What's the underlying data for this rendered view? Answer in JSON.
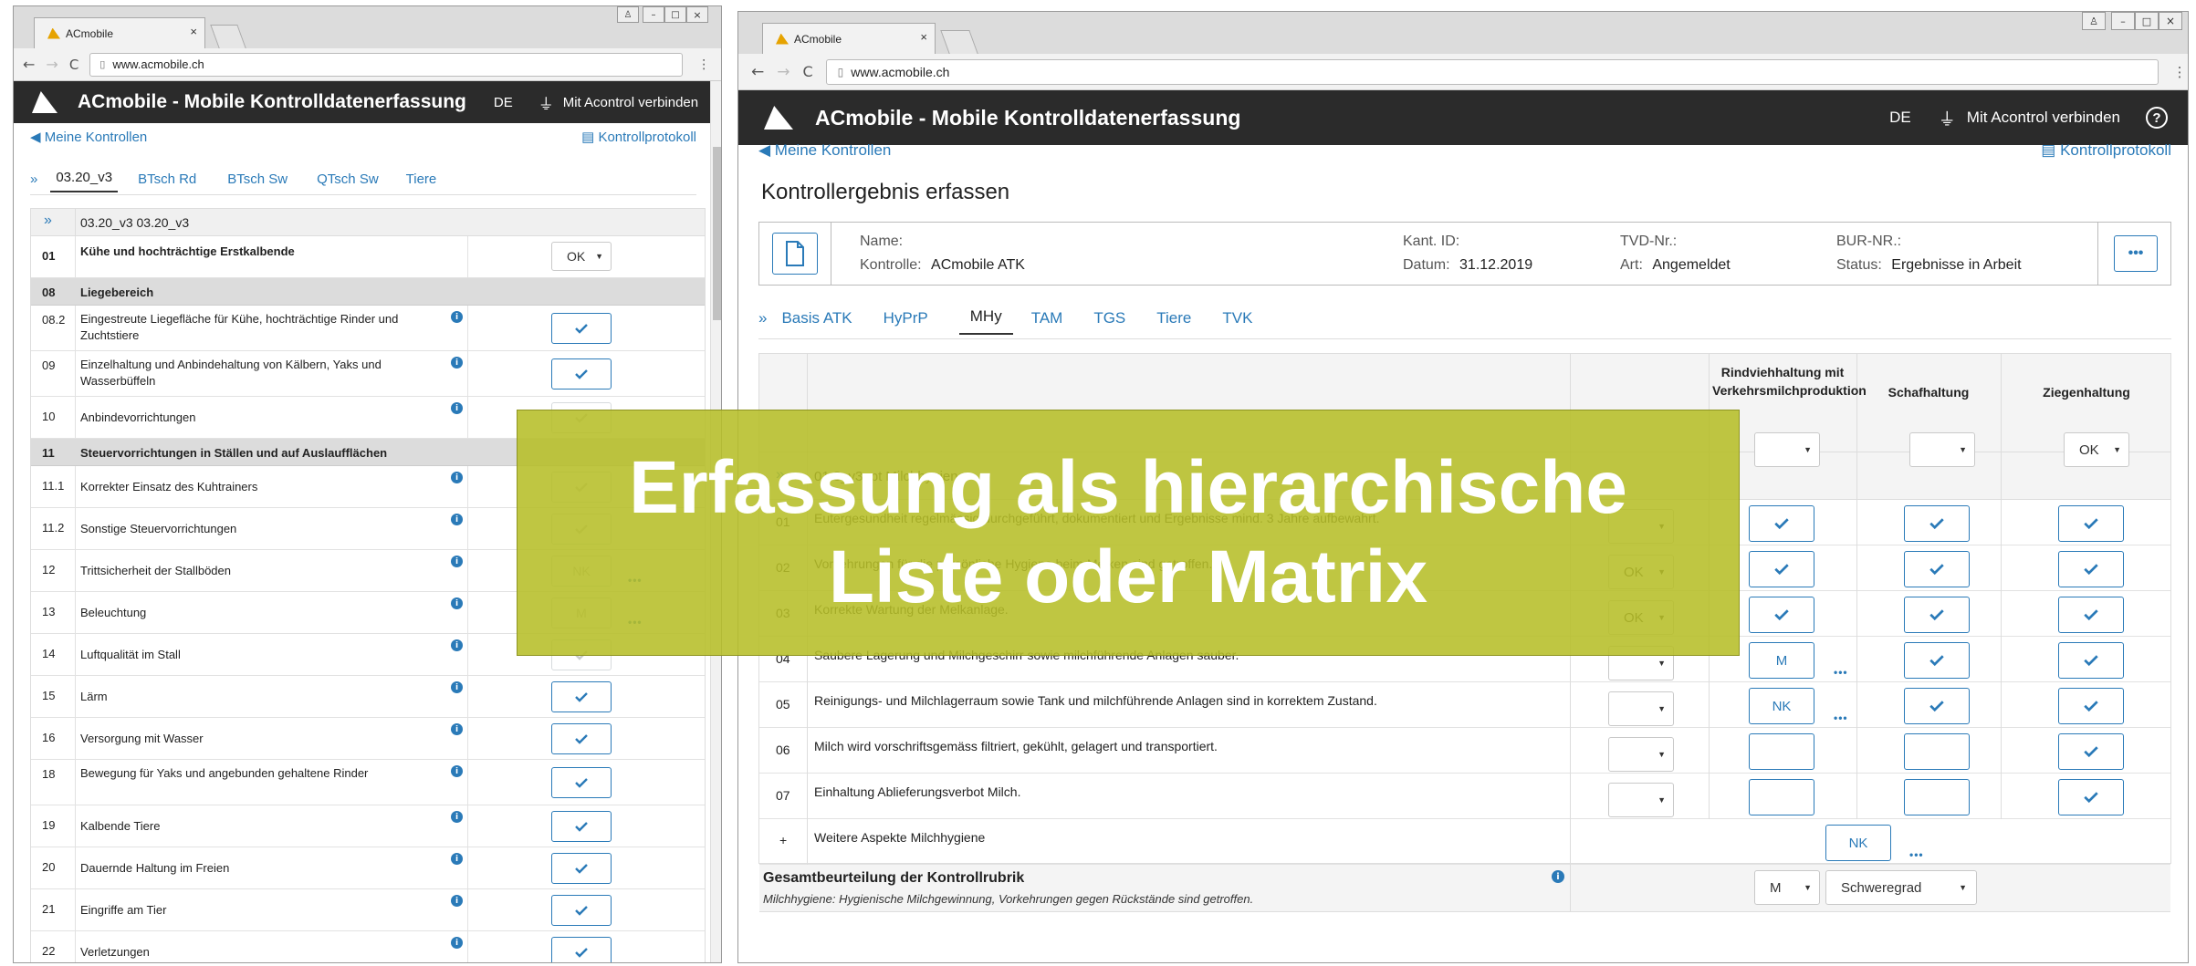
{
  "browser": {
    "tab_title": "ACmobile",
    "url": "www.acmobile.ch"
  },
  "app": {
    "title": "ACmobile - Mobile Kontrolldatenerfassung",
    "lang": "DE",
    "connect": "Mit Acontrol verbinden",
    "help": "?"
  },
  "nav": {
    "back": "Meine Kontrollen",
    "protocol": "Kontrollprotokoll"
  },
  "left": {
    "tabs": [
      "03.20_v3",
      "BTsch Rd",
      "BTsch Sw",
      "QTsch Sw",
      "Tiere"
    ],
    "tabs_prefix": "»",
    "header_code": "»",
    "header_text": "03.20_v3 03.20_v3",
    "rows": [
      {
        "kind": "row",
        "code": "01",
        "text": "Kühe und hochträchtige Erstkalbende",
        "bold": true,
        "control": "select",
        "value": "OK"
      },
      {
        "kind": "section",
        "code": "08",
        "text": "Liegebereich"
      },
      {
        "kind": "row",
        "code": "08.2",
        "text": "Eingestreute Liegefläche für Kühe, hochträchtige Rinder und Zuchtstiere",
        "control": "check",
        "info": true
      },
      {
        "kind": "row",
        "code": "09",
        "text": "Einzelhaltung und Anbindehaltung von Kälbern, Yaks und Wasserbüffeln",
        "control": "check",
        "info": true
      },
      {
        "kind": "row",
        "code": "10",
        "text": "Anbindevorrichtungen",
        "control": "check",
        "info": true,
        "faded": true
      },
      {
        "kind": "section",
        "code": "11",
        "text": "Steuervorrichtungen in Ställen und auf Auslaufflächen"
      },
      {
        "kind": "row",
        "code": "11.1",
        "text": "Korrekter Einsatz des Kuhtrainers",
        "control": "check",
        "info": true,
        "faded": true
      },
      {
        "kind": "row",
        "code": "11.2",
        "text": "Sonstige Steuervorrichtungen",
        "control": "check",
        "info": true,
        "faded": true
      },
      {
        "kind": "row",
        "code": "12",
        "text": "Trittsicherheit der Stallböden",
        "control": "text",
        "value": "NK",
        "info": true,
        "faded": true,
        "dots": true
      },
      {
        "kind": "row",
        "code": "13",
        "text": "Beleuchtung",
        "control": "text",
        "value": "M",
        "info": true,
        "faded": true,
        "dots": true
      },
      {
        "kind": "row",
        "code": "14",
        "text": "Luftqualität im Stall",
        "control": "check",
        "info": true,
        "faded": true
      },
      {
        "kind": "row",
        "code": "15",
        "text": "Lärm",
        "control": "check",
        "info": true
      },
      {
        "kind": "row",
        "code": "16",
        "text": "Versorgung mit Wasser",
        "control": "check",
        "info": true
      },
      {
        "kind": "row",
        "code": "18",
        "text": "Bewegung für Yaks und angebunden gehaltene Rinder",
        "control": "check",
        "info": true
      },
      {
        "kind": "row",
        "code": "19",
        "text": "Kalbende Tiere",
        "control": "check",
        "info": true
      },
      {
        "kind": "row",
        "code": "20",
        "text": "Dauernde Haltung im Freien",
        "control": "check",
        "info": true
      },
      {
        "kind": "row",
        "code": "21",
        "text": "Eingriffe am Tier",
        "control": "check",
        "info": true
      },
      {
        "kind": "row",
        "code": "22",
        "text": "Verletzungen",
        "control": "check",
        "info": true
      }
    ]
  },
  "right": {
    "page_title": "Kontrollergebnis erfassen",
    "card": {
      "name_label": "Name:",
      "name_value": "",
      "kontrolle_label": "Kontrolle:",
      "kontrolle_value": "ACmobile ATK",
      "kant_label": "Kant. ID:",
      "datum_label": "Datum:",
      "datum_value": "31.12.2019",
      "tvd_label": "TVD-Nr.:",
      "art_label": "Art:",
      "art_value": "Angemeldet",
      "bur_label": "BUR-NR.:",
      "status_label": "Status:",
      "status_value": "Ergebnisse in Arbeit",
      "more": "•••"
    },
    "tabs_prefix": "»",
    "tabs": [
      "Basis ATK",
      "HyPrP",
      "MHy",
      "TAM",
      "TGS",
      "Tiere",
      "TVK"
    ],
    "active_tab": 2,
    "columns": [
      "Rindviehhaltung mit Verkehrsmilchproduktion",
      "Schafhaltung",
      "Ziegenhaltung"
    ],
    "section": {
      "code": "»",
      "text": "01.3_v3opt Milchhygiene",
      "top_values": [
        "",
        "",
        "OK"
      ]
    },
    "rows": [
      {
        "code": "01",
        "text": "Eutergesundheit regelmässig durchgeführt, dokumentiert und Ergebnisse mind. 3 Jahre aufbewahrt.",
        "sel": "",
        "cells": [
          "check",
          "check",
          "check"
        ]
      },
      {
        "code": "02",
        "text": "Vorkehrungen für die persönliche Hygiene beim Melken sind getroffen.",
        "sel": "OK",
        "cells": [
          "check",
          "check",
          "check"
        ]
      },
      {
        "code": "03",
        "text": "Korrekte Wartung der Melkanlage.",
        "sel": "OK",
        "cells": [
          "check",
          "check",
          "check"
        ]
      },
      {
        "code": "04",
        "text": "Saubere Lagerung und Milchgeschirr sowie milchführende Anlagen sauber.",
        "sel": "",
        "cells": [
          "M",
          "check",
          "check"
        ],
        "dots": true
      },
      {
        "code": "05",
        "text": "Reinigungs- und Milchlagerraum sowie Tank und milchführende Anlagen sind in korrektem Zustand.",
        "sel": "",
        "cells": [
          "NK",
          "check",
          "check"
        ],
        "dots": true
      },
      {
        "code": "06",
        "text": "Milch wird vorschriftsgemäss filtriert, gekühlt, gelagert und transportiert.",
        "sel": "",
        "cells": [
          "",
          "",
          "check"
        ]
      },
      {
        "code": "07",
        "text": "Einhaltung Ablieferungsverbot Milch.",
        "sel": "",
        "cells": [
          "",
          "",
          "check"
        ]
      }
    ],
    "extra_row": {
      "code": "+",
      "text": "Weitere Aspekte Milchhygiene",
      "value": "NK"
    },
    "summary": {
      "title": "Gesamtbeurteilung der Kontrollrubrik",
      "subtitle": "Milchhygiene: Hygienische Milchgewinnung, Vorkehrungen gegen Rückstände sind getroffen.",
      "value": "M",
      "severity": "Schweregrad"
    }
  },
  "overlay": {
    "line1": "Erfassung als hierarchische",
    "line2": "Liste oder Matrix"
  }
}
